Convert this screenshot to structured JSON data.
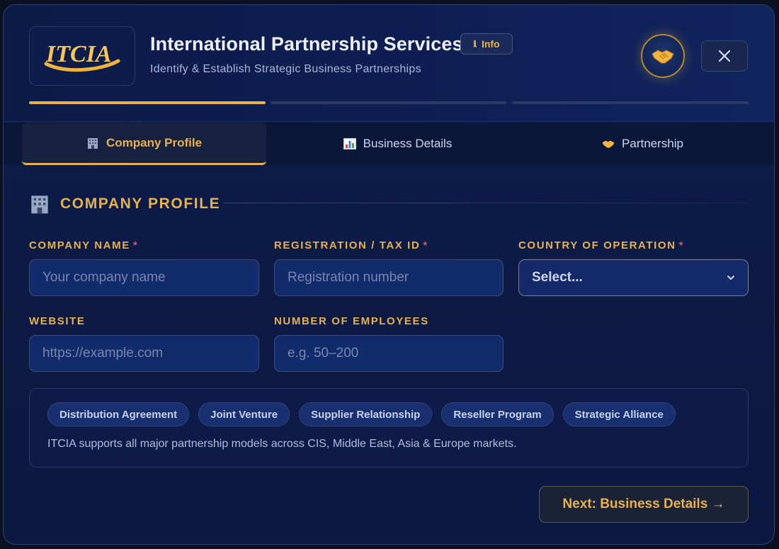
{
  "header": {
    "logo_text": "ITCIA",
    "title": "International Partnership Services",
    "info_label": "Info",
    "subtitle": "Identify & Establish Strategic Business Partnerships",
    "progress": {
      "current_step": 1,
      "total_steps": 3
    }
  },
  "tabs": [
    {
      "label": "Company Profile",
      "icon": "building-icon",
      "active": true
    },
    {
      "label": "Business Details",
      "icon": "bar-chart-icon",
      "active": false
    },
    {
      "label": "Partnership",
      "icon": "handshake-icon",
      "active": false
    }
  ],
  "section": {
    "title": "COMPANY PROFILE",
    "icon": "building-icon"
  },
  "fields": {
    "company_name": {
      "label": "COMPANY NAME",
      "required": "*",
      "value": "",
      "placeholder": "Your company name"
    },
    "registration": {
      "label": "REGISTRATION / TAX ID",
      "required": "*",
      "value": "",
      "placeholder": "Registration number"
    },
    "country": {
      "label": "COUNTRY OF OPERATION",
      "required": "*",
      "selected": "Select..."
    },
    "website": {
      "label": "WEBSITE",
      "value": "",
      "placeholder": "https://example.com"
    },
    "employees": {
      "label": "NUMBER OF EMPLOYEES",
      "value": "",
      "placeholder": "e.g. 50–200"
    }
  },
  "models": {
    "chips": [
      "Distribution Agreement",
      "Joint Venture",
      "Supplier Relationship",
      "Reseller Program",
      "Strategic Alliance"
    ],
    "note": "ITCIA supports all major partnership models across CIS, Middle East, Asia & Europe markets."
  },
  "actions": {
    "next_label": "Next: Business Details →"
  },
  "colors": {
    "accent": "#e7b24a",
    "required": "#e05757",
    "background": "#0c1a46"
  }
}
